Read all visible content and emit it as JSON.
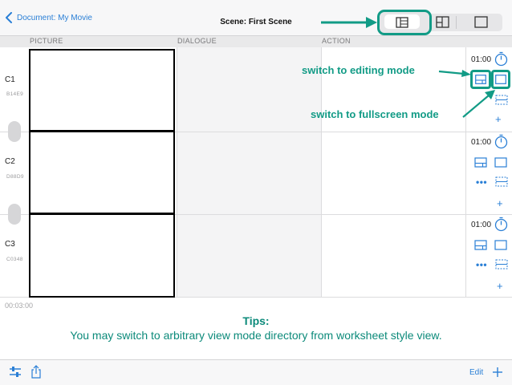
{
  "nav": {
    "back_label": "Document: My Movie",
    "title": "Scene: First Scene"
  },
  "columns": {
    "picture": "PICTURE",
    "dialogue": "DIALOGUE",
    "action": "ACTION"
  },
  "cuts": [
    {
      "label": "C1",
      "code": "B14E9",
      "duration": "01:00"
    },
    {
      "label": "C2",
      "code": "D88D9",
      "duration": "01:00"
    },
    {
      "label": "C3",
      "code": "C0348",
      "duration": "01:00"
    }
  ],
  "total_time": "00:03:00",
  "tips": {
    "title": "Tips:",
    "body": "You may switch to arbitrary view mode directory from worksheet style view."
  },
  "annotations": {
    "editing": "switch to editing mode",
    "fullscreen": "switch to fullscreen mode"
  },
  "toolbar": {
    "edit_label": "Edit"
  },
  "colors": {
    "accent": "#2a7fd6",
    "annotation": "#129b86"
  },
  "icons": [
    "chevron-left-icon",
    "worksheet-view-icon",
    "editing-view-icon",
    "fullscreen-view-icon",
    "timer-icon",
    "more-icon",
    "add-icon",
    "settings-sliders-icon",
    "share-icon",
    "plus-icon"
  ]
}
